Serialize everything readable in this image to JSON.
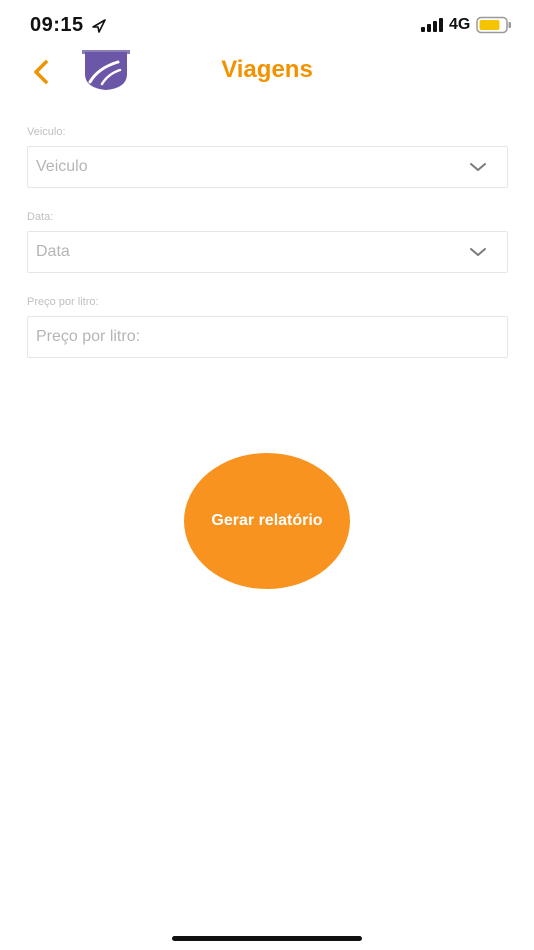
{
  "status_bar": {
    "time": "09:15",
    "network": "4G",
    "battery_color": "#f5c400"
  },
  "header": {
    "title": "Viagens",
    "accent_color": "#f39200",
    "back_icon": "chevron-left-icon",
    "logo_icon": "road-shield-icon",
    "logo_color": "#6b56a8"
  },
  "form": {
    "vehicle": {
      "label": "Veiculo:",
      "value": "Veiculo"
    },
    "date": {
      "label": "Data:",
      "value": "Data"
    },
    "price": {
      "label": "Preço por litro:",
      "placeholder": "Preço por litro:"
    }
  },
  "actions": {
    "generate_report_label": "Gerar relatório",
    "button_color": "#f7931e"
  }
}
